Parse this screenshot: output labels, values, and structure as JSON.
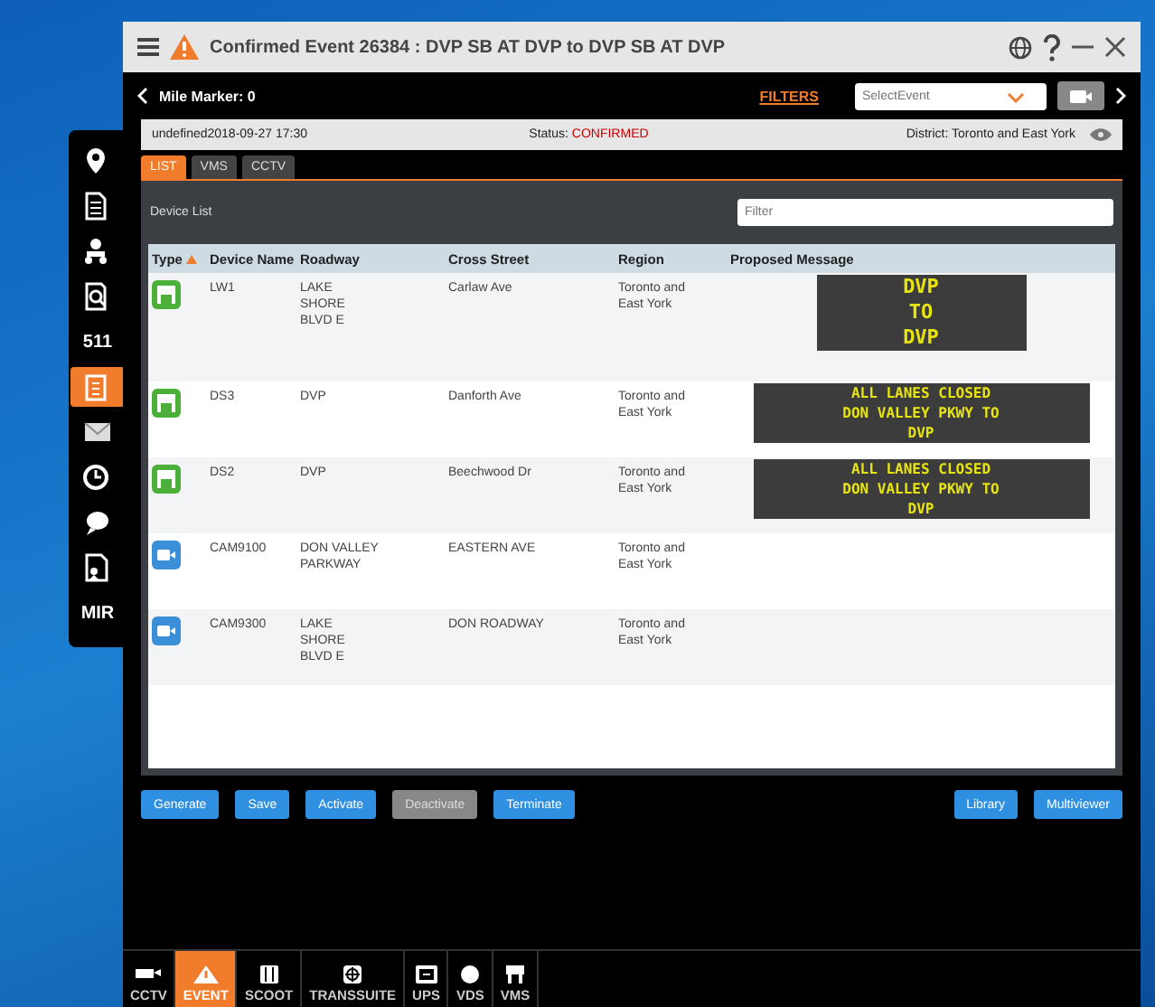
{
  "window": {
    "title": "Confirmed Event 26384 : DVP SB AT DVP to DVP SB AT DVP"
  },
  "nav": {
    "mile_marker": "Mile Marker: 0",
    "filters": "FILTERS",
    "event_select": {
      "placeholder": "SelectEvent"
    }
  },
  "info_bar": {
    "timestamp": "undefined2018-09-27 17:30",
    "status_label": "Status:",
    "status": "CONFIRMED",
    "district": "District: Toronto and East York"
  },
  "sidebar": {
    "items": [
      {
        "kind": "pin",
        "selected": false
      },
      {
        "kind": "document",
        "selected": false
      },
      {
        "kind": "org",
        "selected": false
      },
      {
        "kind": "search-doc",
        "selected": false
      },
      {
        "kind": "text",
        "label": "511",
        "selected": false
      },
      {
        "kind": "clipboard",
        "selected": true
      },
      {
        "kind": "mail",
        "selected": false
      },
      {
        "kind": "clock",
        "selected": false
      },
      {
        "kind": "chat",
        "selected": false
      },
      {
        "kind": "doc-person",
        "selected": false
      },
      {
        "kind": "text",
        "label": "MIR",
        "selected": false
      }
    ]
  },
  "tabs": [
    {
      "label": "LIST",
      "selected": true
    },
    {
      "label": "VMS",
      "selected": false
    },
    {
      "label": "CCTV",
      "selected": false
    }
  ],
  "device_list": {
    "title": "Device List",
    "filter": {
      "placeholder": "Filter"
    }
  },
  "table": {
    "columns": [
      "Type",
      "Device Name",
      "Roadway",
      "Cross Street",
      "Region",
      "Proposed Message"
    ],
    "rows": [
      {
        "kind": "vms",
        "name": "LW1",
        "roadway": "LAKE SHORE BLVD E",
        "cross_street": "Carlaw Ave",
        "region": "Toronto and East York",
        "message": [
          "DVP",
          "TO",
          "DVP"
        ]
      },
      {
        "kind": "vms",
        "name": "DS3",
        "roadway": "DVP",
        "cross_street": "Danforth Ave",
        "region": "Toronto and East York",
        "message": [
          "ALL LANES CLOSED",
          "DON VALLEY PKWY TO",
          "DVP"
        ]
      },
      {
        "kind": "vms",
        "name": "DS2",
        "roadway": "DVP",
        "cross_street": "Beechwood Dr",
        "region": "Toronto and East York",
        "message": [
          "ALL LANES CLOSED",
          "DON VALLEY PKWY TO",
          "DVP"
        ]
      },
      {
        "kind": "camera",
        "name": "CAM9100",
        "roadway": "DON VALLEY PARKWAY",
        "cross_street": "EASTERN AVE",
        "region": "Toronto and East York",
        "message": []
      },
      {
        "kind": "camera",
        "name": "CAM9300",
        "roadway": "LAKE SHORE BLVD E",
        "cross_street": "DON ROADWAY",
        "region": "Toronto and East York",
        "message": []
      }
    ]
  },
  "actions": [
    {
      "label": "Generate",
      "disabled": false
    },
    {
      "label": "Save",
      "disabled": false
    },
    {
      "label": "Activate",
      "disabled": false
    },
    {
      "label": "Deactivate",
      "disabled": true
    },
    {
      "label": "Terminate",
      "disabled": false
    }
  ],
  "actions_right": [
    {
      "label": "Library",
      "disabled": false
    },
    {
      "label": "Multiviewer",
      "disabled": false
    }
  ],
  "taskbar": [
    {
      "kind": "camera",
      "label": "CCTV",
      "selected": false
    },
    {
      "kind": "warning",
      "label": "EVENT",
      "selected": true
    },
    {
      "kind": "scoot",
      "label": "SCOOT",
      "selected": false
    },
    {
      "kind": "grid",
      "label": "TRANSSUITE",
      "selected": false
    },
    {
      "kind": "ups",
      "label": "UPS",
      "selected": false
    },
    {
      "kind": "dot",
      "label": "VDS",
      "selected": false
    },
    {
      "kind": "sign",
      "label": "VMS",
      "selected": false
    }
  ]
}
